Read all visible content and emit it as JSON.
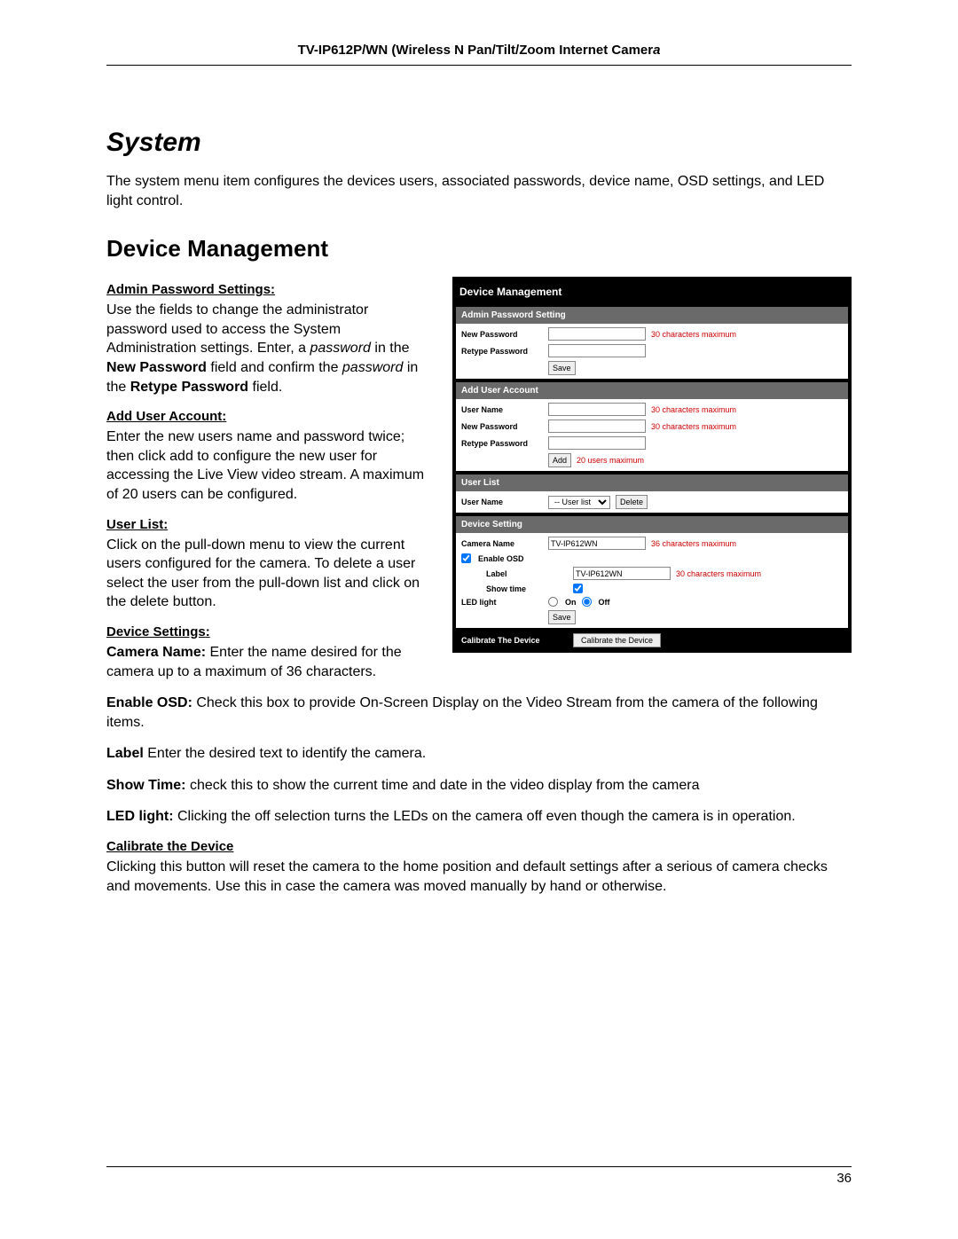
{
  "header": {
    "title_prefix": "TV-IP612P/WN (Wireless N Pan/Tilt/Zoom Internet Camer",
    "title_em": "a"
  },
  "section_title": "System",
  "intro": "The system menu item configures the devices users, associated passwords, device name, OSD settings, and LED light control.",
  "h2": "Device Management",
  "admin_heading": "Admin Password Settings",
  "admin_text_a": "Use the fields to change the administrator password used to access the System Administration settings. Enter, a ",
  "admin_text_b": "password",
  "admin_text_c": " in the ",
  "admin_text_d": "New Password",
  "admin_text_e": " field and confirm the ",
  "admin_text_f": "password",
  "admin_text_g": " in the ",
  "admin_text_h": "Retype Password",
  "admin_text_i": " field.",
  "add_user_heading": "Add User Account",
  "add_user_text": "Enter the new users name and password twice; then click add to configure the new user for accessing the Live View video stream. A maximum of 20 users can be configured.",
  "user_list_heading": "User List",
  "user_list_text": "Click on the pull-down menu to view the current users configured for the camera. To delete a user select the user from the pull-down list and click on the delete button.",
  "device_settings_heading": "Device Settings",
  "camera_name_label": "Camera Name:",
  "camera_name_text": " Enter the name desired for the camera up to a maximum of 36 characters.",
  "enable_osd_label": "Enable OSD:",
  "enable_osd_text": " Check this box to provide On-Screen Display on the Video Stream from the camera of the following items.",
  "label_label": "Label",
  "label_text": "  Enter the desired text to identify the camera.",
  "showtime_label": "Show Time:",
  "showtime_text": " check this to show the current time and date in the video display from the camera",
  "led_label": "LED light:",
  "led_text": " Clicking the off selection turns the LEDs on the camera off even though the camera is in operation.",
  "calibrate_heading": "Calibrate the Device",
  "calibrate_text": "Clicking this button will reset the camera to the home position and default settings after a serious of camera checks and movements. Use this in case the camera was moved manually by hand or otherwise.",
  "page_number": "36",
  "colon": ":",
  "panel": {
    "title": "Device Management",
    "admin_section": "Admin Password Setting",
    "new_password": "New Password",
    "retype_password": "Retype Password",
    "hint30": "30 characters maximum",
    "save": "Save",
    "add_user_section": "Add User Account",
    "user_name": "User Name",
    "add": "Add",
    "hint20": "20 users maximum",
    "user_list_section": "User List",
    "user_list_placeholder": "-- User list --",
    "delete": "Delete",
    "device_setting_section": "Device Setting",
    "camera_name": "Camera Name",
    "camera_name_value": "TV-IP612WN",
    "hint36": "36 characters maximum",
    "enable_osd": "Enable OSD",
    "label_field": "Label",
    "label_value": "TV-IP612WN",
    "show_time": "Show time",
    "led_light": "LED light",
    "on": "On",
    "off": "Off",
    "calibrate_section": "Calibrate The Device",
    "calibrate_button": "Calibrate the Device"
  }
}
